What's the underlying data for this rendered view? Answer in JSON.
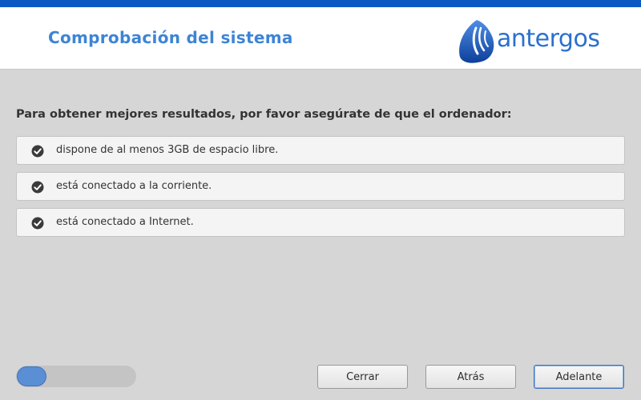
{
  "header": {
    "title": "Comprobación del sistema",
    "logo_text": "antergos"
  },
  "main": {
    "intro": "Para obtener mejores resultados, por favor asegúrate de que el ordenador:",
    "requirements": [
      {
        "label": "dispone de al menos 3GB de espacio libre.",
        "icon": "check-circle-icon",
        "met": true
      },
      {
        "label": "está conectado a la corriente.",
        "icon": "check-circle-icon",
        "met": true
      },
      {
        "label": "está conectado a Internet.",
        "icon": "check-circle-icon",
        "met": true
      }
    ]
  },
  "footer": {
    "progress_fraction": 0.25,
    "buttons": {
      "close": "Cerrar",
      "back": "Atrás",
      "next": "Adelante"
    }
  },
  "colors": {
    "accent": "#0b58c5",
    "title": "#3d84d6",
    "background": "#d6d6d6"
  }
}
